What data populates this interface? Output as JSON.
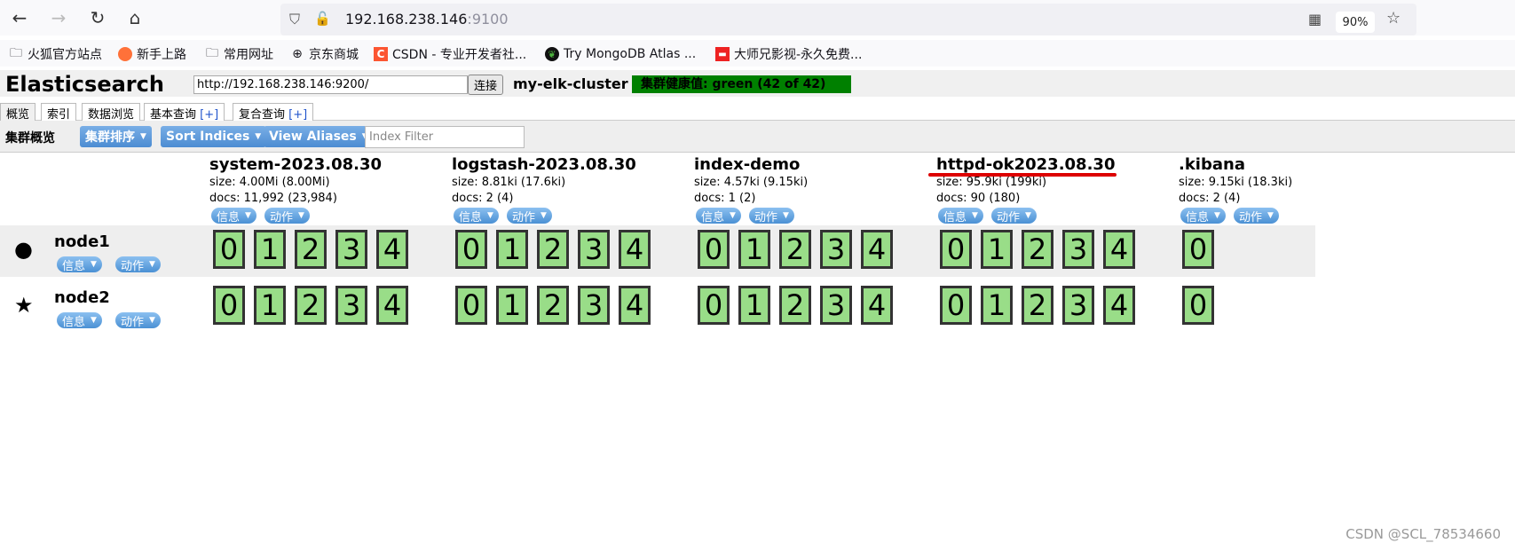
{
  "browser": {
    "url_host": "192.168.238.146",
    "url_port": ":9100",
    "zoom": "90%",
    "bookmarks": [
      "火狐官方站点",
      "新手上路",
      "常用网址",
      "京东商城",
      "CSDN - 专业开发者社...",
      "Try MongoDB Atlas ...",
      "大师兄影视-永久免费..."
    ]
  },
  "app": {
    "title": "Elasticsearch",
    "connect_url": "http://192.168.238.146:9200/",
    "connect_label": "连接",
    "cluster_name": "my-elk-cluster",
    "health": "集群健康值: green (42 of 42)",
    "tabs": [
      {
        "label": "概览",
        "plus": ""
      },
      {
        "label": "索引",
        "plus": ""
      },
      {
        "label": "数据浏览",
        "plus": ""
      },
      {
        "label": "基本查询 ",
        "plus": "[+]"
      },
      {
        "label": "复合查询 ",
        "plus": "[+]"
      }
    ],
    "overview_title": "集群概览",
    "sort_cluster": "集群排序",
    "sort_indices": "Sort Indices",
    "view_aliases": "View Aliases",
    "index_filter_placeholder": "Index Filter",
    "info_label": "信息",
    "action_label": "动作"
  },
  "indices": [
    {
      "name": "system-2023.08.30",
      "size": "size: 4.00Mi (8.00Mi)",
      "docs": "docs: 11,992 (23,984)",
      "shards": [
        "0",
        "1",
        "2",
        "3",
        "4"
      ]
    },
    {
      "name": "logstash-2023.08.30",
      "size": "size: 8.81ki (17.6ki)",
      "docs": "docs: 2 (4)",
      "shards": [
        "0",
        "1",
        "2",
        "3",
        "4"
      ]
    },
    {
      "name": "index-demo",
      "size": "size: 4.57ki (9.15ki)",
      "docs": "docs: 1 (2)",
      "shards": [
        "0",
        "1",
        "2",
        "3",
        "4"
      ]
    },
    {
      "name": "httpd-ok2023.08.30",
      "size": "size: 95.9ki (199ki)",
      "docs": "docs: 90 (180)",
      "shards": [
        "0",
        "1",
        "2",
        "3",
        "4"
      ]
    },
    {
      "name": ".kibana",
      "size": "size: 9.15ki (18.3ki)",
      "docs": "docs: 2 (4)",
      "shards": [
        "0"
      ]
    }
  ],
  "nodes": [
    {
      "name": "node1",
      "icon": "circle-icon",
      "glyph": "●"
    },
    {
      "name": "node2",
      "icon": "star-icon",
      "glyph": "★"
    }
  ],
  "watermark": "CSDN @SCL_78534660",
  "colors": {
    "health_green": "#008000",
    "shard_green": "#99dd88",
    "button_blue": "#4c8cd2"
  }
}
